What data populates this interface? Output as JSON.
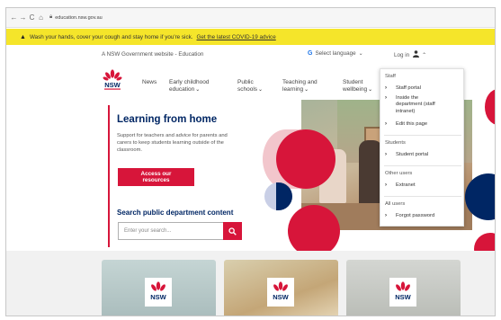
{
  "browser": {
    "url": "education.nsw.gov.au"
  },
  "banner": {
    "message": "Wash your hands, cover your cough and stay home if you're sick.",
    "link": "Get the latest COVID-19 advice"
  },
  "utility": {
    "gov_text": "A NSW Government website - Education",
    "language": "Select language",
    "login": "Log in"
  },
  "nav": {
    "items": [
      {
        "line1": "News",
        "line2": "",
        "chevron": false
      },
      {
        "line1": "Early childhood",
        "line2": "education",
        "chevron": true
      },
      {
        "line1": "Public",
        "line2": "schools",
        "chevron": true
      },
      {
        "line1": "Teaching and",
        "line2": "learning",
        "chevron": true
      },
      {
        "line1": "Student",
        "line2": "wellbeing",
        "chevron": true
      }
    ]
  },
  "hero": {
    "title": "Learning from home",
    "text": "Support for teachers and advice for parents and carers to keep students learning outside of the classroom.",
    "cta_line1": "Access our",
    "cta_line2": "resources",
    "search_label": "Search public department content",
    "search_placeholder": "Enter your search..."
  },
  "menu": {
    "staff_head": "Staff",
    "staff_portal": "Staff portal",
    "inside_dept": [
      "Inside the",
      "department (staff",
      "intranet)"
    ],
    "edit_page": "Edit this page",
    "students_head": "Students",
    "student_portal": "Student portal",
    "other_head": "Other users",
    "extranet": "Extranet",
    "all_head": "All users",
    "forgot": "Forgot password"
  },
  "colors": {
    "nsw_red": "#d7153a",
    "nsw_navy": "#002664",
    "banner_yellow": "#f5e52a"
  }
}
